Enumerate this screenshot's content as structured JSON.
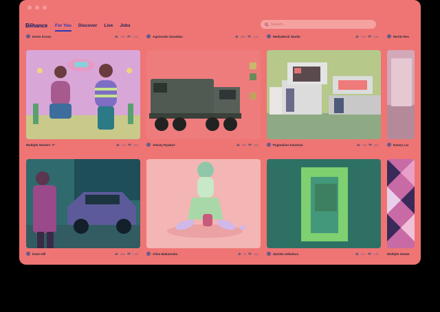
{
  "app": {
    "brand": "Bēhance"
  },
  "nav": {
    "items": [
      {
        "label": "For You",
        "active": true
      },
      {
        "label": "Discover",
        "active": false
      },
      {
        "label": "Live",
        "active": false
      },
      {
        "label": "Jobs",
        "active": false
      }
    ],
    "search_placeholder": "Search..."
  },
  "rows": [
    {
      "meta": [
        {
          "owner": "Denis Kovac",
          "likes": "781",
          "views": "7.9K"
        },
        {
          "owner": "Agnieszka Szuałaka",
          "likes": "389",
          "views": "1.4K"
        },
        {
          "owner": "MediaWork Studio",
          "likes": "275",
          "views": "1.5K"
        },
        {
          "owner": "Moritz Rec"
        }
      ]
    },
    {
      "meta": [
        {
          "owner": "Multiple Owners",
          "likes": "121",
          "views": "825"
        },
        {
          "owner": "Alexey Ryabov",
          "likes": "295",
          "views": "859"
        },
        {
          "owner": "Pygmalion Karatzas",
          "likes": "109",
          "views": "687"
        },
        {
          "owner": "Danny Lar"
        }
      ]
    },
    {
      "meta": [
        {
          "owner": "Dave Hill",
          "likes": "358",
          "views": "1.4K"
        },
        {
          "owner": "Alina Makarenko",
          "likes": "76",
          "views": "282"
        },
        {
          "owner": "daniela mikulova",
          "likes": "277",
          "views": "1.4K"
        },
        {
          "owner": "Multiple Owner"
        }
      ]
    }
  ],
  "colors": {
    "window": "#ee7574",
    "accent": "#2d36b8",
    "brand": "#0c1966"
  }
}
